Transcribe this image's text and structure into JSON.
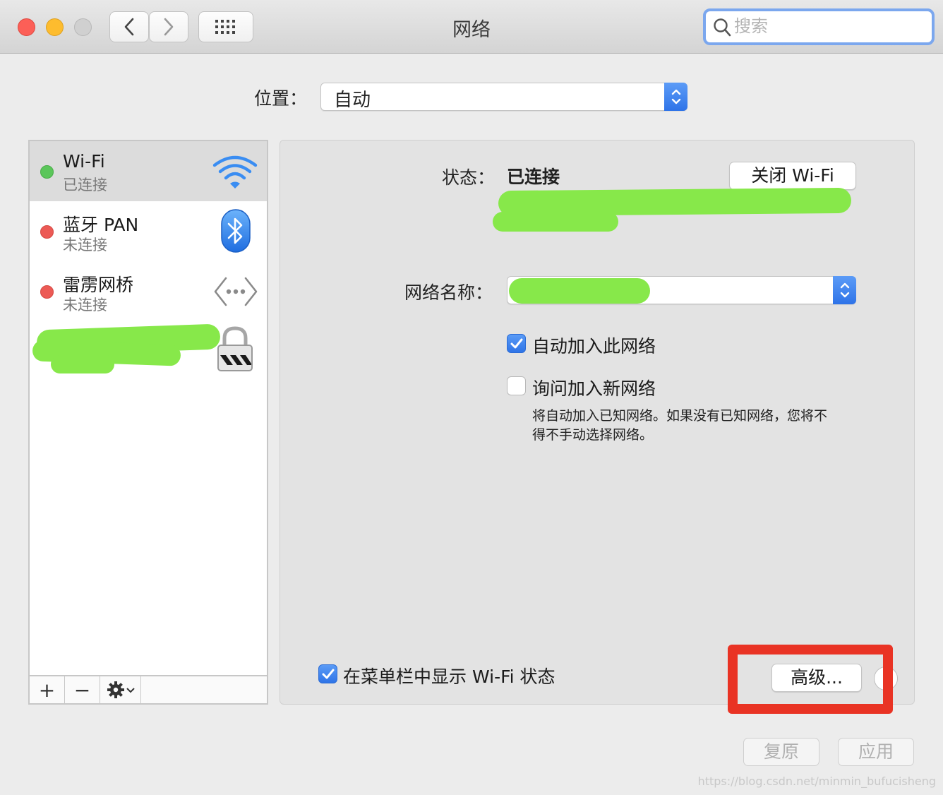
{
  "window": {
    "title": "网络"
  },
  "search": {
    "placeholder": "搜索"
  },
  "location": {
    "label": "位置：",
    "value": "自动"
  },
  "services": [
    {
      "name": "Wi-Fi",
      "status": "已连接",
      "status_color": "#5bc65a",
      "icon": "wifi-icon",
      "selected": true
    },
    {
      "name": "蓝牙 PAN",
      "status": "未连接",
      "status_color": "#ec5a55",
      "icon": "bluetooth-icon",
      "selected": false
    },
    {
      "name": "雷雳网桥",
      "status": "未连接",
      "status_color": "#ec5a55",
      "icon": "thunderbolt-bridge-icon",
      "selected": false
    }
  ],
  "sidebar_toolbar": {
    "add": "+",
    "remove": "−"
  },
  "detail": {
    "status_label": "状态：",
    "status_value": "已连接",
    "turn_off_button": "关闭 Wi-Fi",
    "network_name_label": "网络名称：",
    "auto_join_label": "自动加入此网络",
    "auto_join_checked": true,
    "ask_join_label": "询问加入新网络",
    "ask_join_checked": false,
    "ask_join_note_line1": "将自动加入已知网络。如果没有已知网络，您将不",
    "ask_join_note_line2": "得不手动选择网络。",
    "show_menubar_label": "在菜单栏中显示 Wi-Fi 状态",
    "show_menubar_checked": true,
    "advanced_button": "高级..."
  },
  "footer": {
    "revert_button": "复原",
    "apply_button": "应用"
  },
  "watermark": "https://blog.csdn.net/minmin_bufucisheng",
  "colors": {
    "accent": "#2f74e7",
    "highlight_box": "#e93324",
    "redaction": "#87e84a"
  }
}
